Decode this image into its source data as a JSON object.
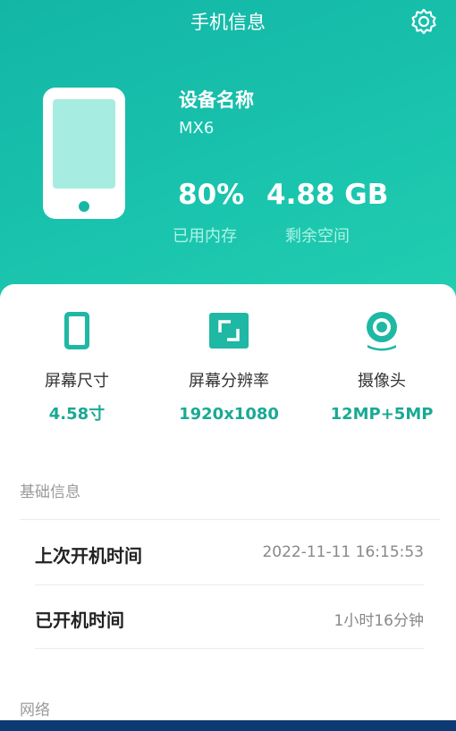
{
  "app_title": "手机信息",
  "device": {
    "label": "设备名称",
    "value": "MX6"
  },
  "stats": [
    {
      "value": "80%",
      "caption": "已用内存"
    },
    {
      "value": "4.88 GB",
      "caption": "剩余空间"
    }
  ],
  "specs": [
    {
      "label": "屏幕尺寸",
      "value": "4.58寸",
      "icon": "phone-icon"
    },
    {
      "label": "屏幕分辨率",
      "value": "1920x1080",
      "icon": "screen-resolution-icon"
    },
    {
      "label": "摄像头",
      "value": "12MP+5MP",
      "icon": "camera-icon"
    }
  ],
  "sections": {
    "basic": {
      "title": "基础信息",
      "rows": [
        {
          "label": "上次开机时间",
          "value": "2022-11-11 16:15:53"
        },
        {
          "label": "已开机时间",
          "value": "1小时16分钟"
        }
      ]
    },
    "network": {
      "title": "网络"
    }
  },
  "colors": {
    "accent": "#1aa994",
    "header_start": "#13b6a6",
    "header_end": "#22cfb0",
    "bottom_bar": "#0d3a73"
  },
  "icons": {
    "settings": "gear-icon"
  }
}
